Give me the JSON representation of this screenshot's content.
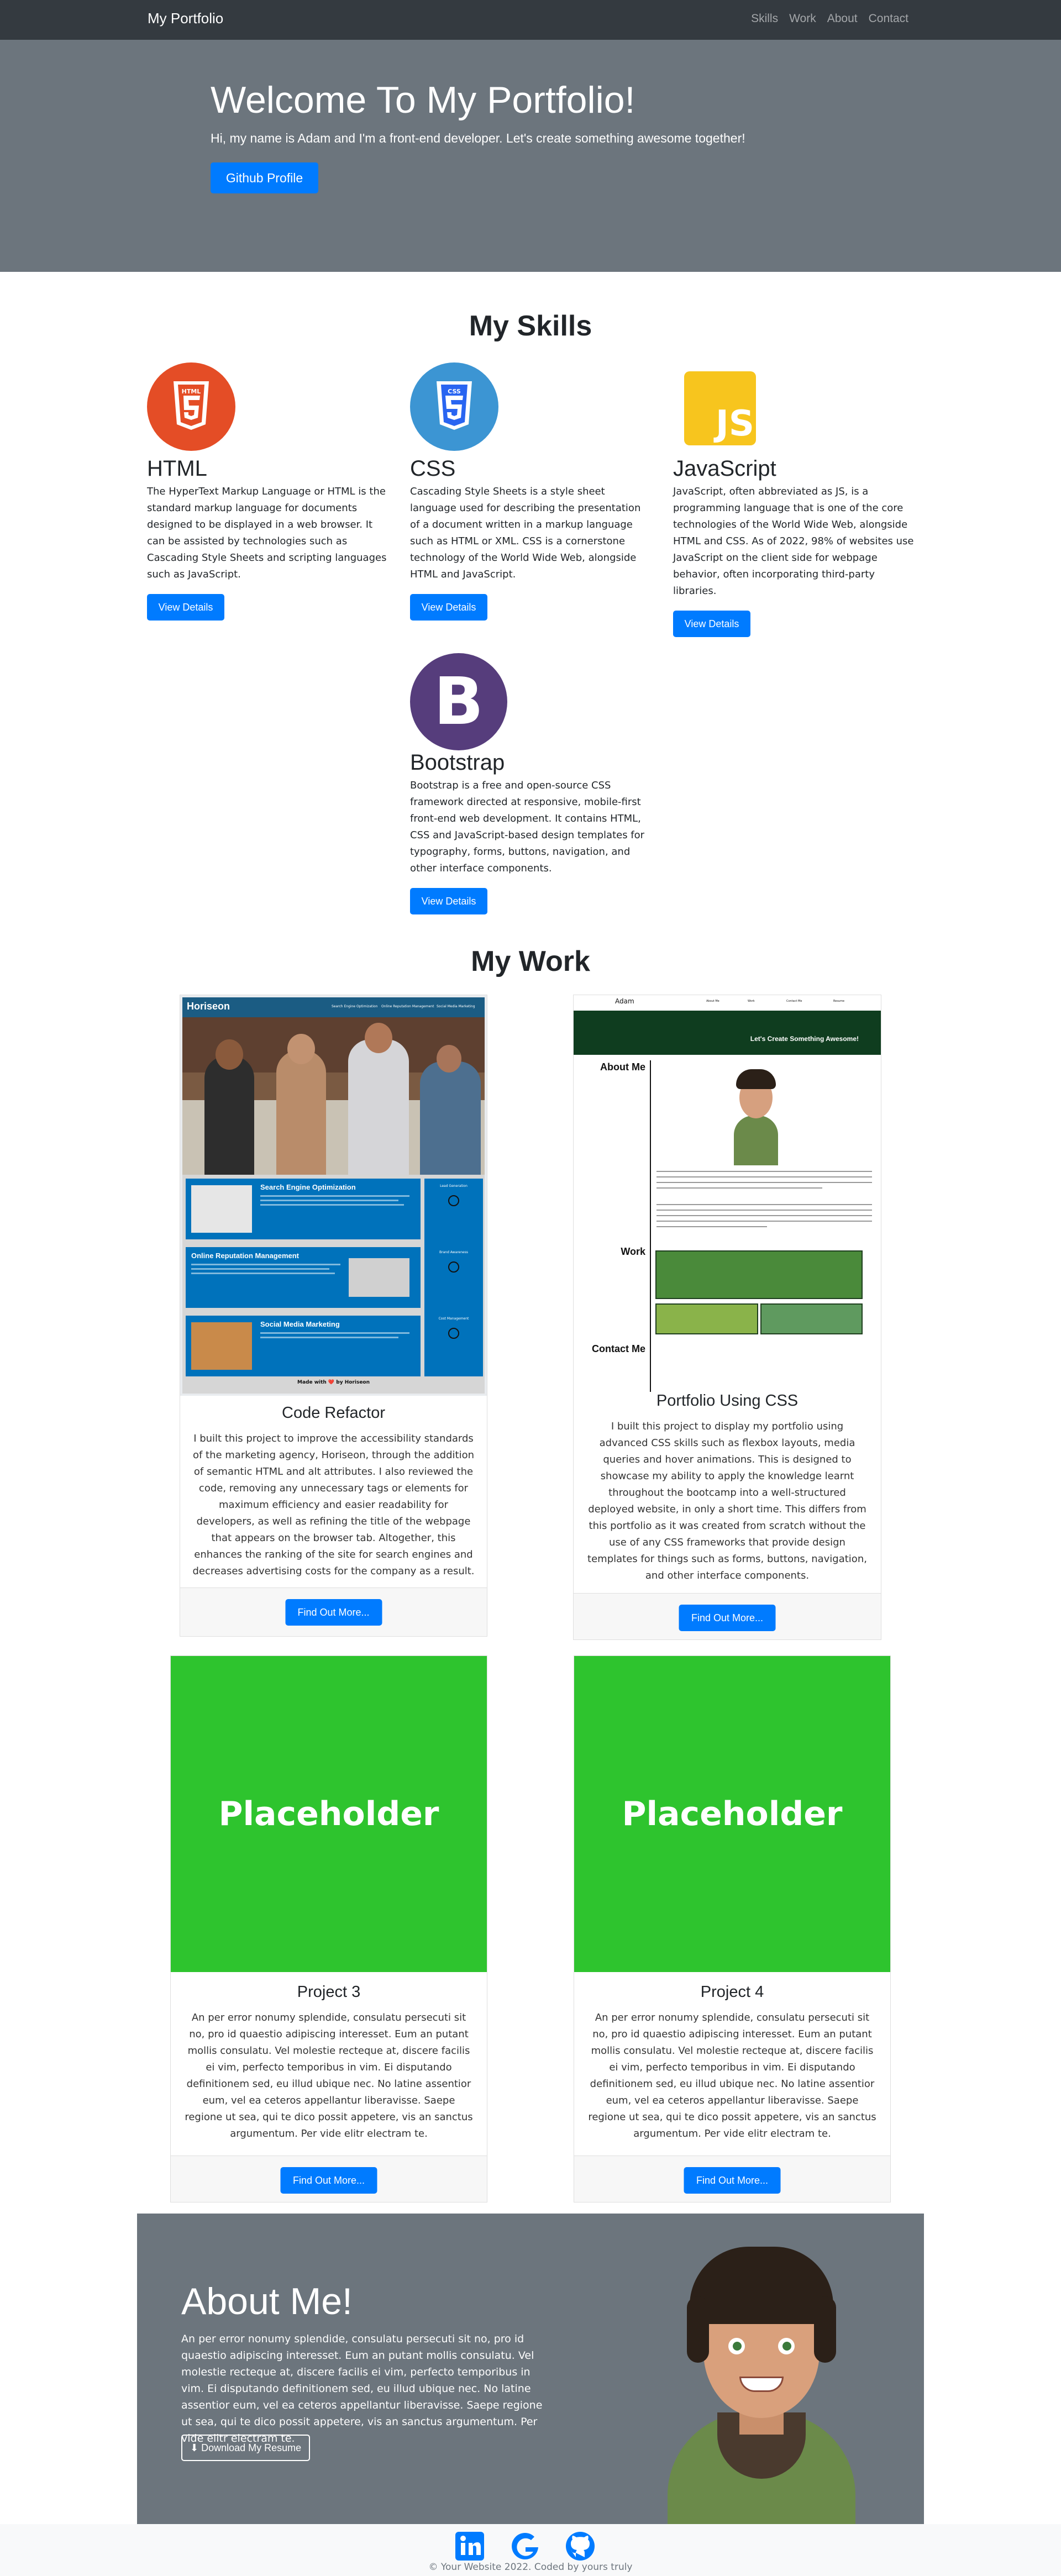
{
  "navbar": {
    "brand": "My Portfolio",
    "links": [
      "Skills",
      "Work",
      "About",
      "Contact"
    ]
  },
  "hero": {
    "title": "Welcome To My Portfolio!",
    "subtitle": "Hi, my name is Adam and I'm a front-end developer. Let's create something awesome together!",
    "button": "Github Profile"
  },
  "skills": {
    "title": "My Skills",
    "items": [
      {
        "name": "HTML",
        "logo_text": "HTML",
        "color": "#e44d26",
        "desc": "The HyperText Markup Language or HTML is the standard markup language for documents designed to be displayed in a web browser. It can be assisted by technologies such as Cascading Style Sheets and scripting languages such as JavaScript.",
        "button": "View Details"
      },
      {
        "name": "CSS",
        "logo_text": "CSS",
        "color": "#2965f1",
        "desc": "Cascading Style Sheets is a style sheet language used for describing the presentation of a document written in a markup language such as HTML or XML. CSS is a cornerstone technology of the World Wide Web, alongside HTML and JavaScript.",
        "button": "View Details"
      },
      {
        "name": "JavaScript",
        "logo_text": "JS",
        "color": "#f7df1e",
        "desc": "JavaScript, often abbreviated as JS, is a programming language that is one of the core technologies of the World Wide Web, alongside HTML and CSS. As of 2022, 98% of websites use JavaScript on the client side for webpage behavior, often incorporating third-party libraries.",
        "button": "View Details"
      },
      {
        "name": "Bootstrap",
        "logo_text": "B",
        "color": "#563d7c",
        "desc": "Bootstrap is a free and open-source CSS framework directed at responsive, mobile-first front-end web development. It contains HTML, CSS and JavaScript-based design templates for typography, forms, buttons, navigation, and other interface components.",
        "button": "View Details"
      }
    ]
  },
  "work": {
    "title": "My Work",
    "cards": [
      {
        "title": "Code Refactor",
        "desc": "I built this project to improve the accessibility standards of the marketing agency, Horiseon, through the addition of semantic HTML and alt attributes. I also reviewed the code, removing any unnecessary tags or elements for maximum efficiency and easier readability for developers, as well as refining the title of the webpage that appears on the browser tab. Altogether, this enhances the ranking of the site for search engines and decreases advertising costs for the company as a result.",
        "button": "Find Out More...",
        "thumb": {
          "brand": "Horiseon",
          "nav": [
            "Search Engine Optimization",
            "Online Reputation Management",
            "Social Media Marketing"
          ],
          "sections": [
            "Search Engine Optimization",
            "Online Reputation Management",
            "Social Media Marketing"
          ],
          "sidebar": [
            "Lead Generation",
            "Brand Awareness",
            "Cost Management"
          ],
          "footer": "Made with ❤️ by Horiseon"
        }
      },
      {
        "title": "Portfolio Using CSS",
        "desc": "I built this project to display my portfolio using advanced CSS skills such as flexbox layouts, media queries and hover animations. This is designed to showcase my ability to apply the knowledge learnt throughout the bootcamp into a well-structured deployed website, in only a short time. This differs from this portfolio as it was created from scratch without the use of any CSS frameworks that provide design templates for things such as forms, buttons, navigation, and other interface components.",
        "button": "Find Out More...",
        "thumb": {
          "brand": "Adam",
          "nav": [
            "About Me",
            "Work",
            "Contact Me",
            "Resume"
          ],
          "banner": "Let's Create Something Awesome!",
          "sections": [
            "About Me",
            "Work",
            "Contact Me"
          ]
        }
      },
      {
        "title": "Project 3",
        "placeholder": "Placeholder",
        "desc": "An per error nonumy splendide, consulatu persecuti sit no, pro id quaestio adipiscing interesset. Eum an putant mollis consulatu. Vel molestie recteque at, discere facilis ei vim, perfecto temporibus in vim. Ei disputando definitionem sed, eu illud ubique nec. No latine assentior eum, vel ea ceteros appellantur liberavisse. Saepe regione ut sea, qui te dico possit appetere, vis an sanctus argumentum. Per vide elitr electram te.",
        "button": "Find Out More..."
      },
      {
        "title": "Project 4",
        "placeholder": "Placeholder",
        "desc": "An per error nonumy splendide, consulatu persecuti sit no, pro id quaestio adipiscing interesset. Eum an putant mollis consulatu. Vel molestie recteque at, discere facilis ei vim, perfecto temporibus in vim. Ei disputando definitionem sed, eu illud ubique nec. No latine assentior eum, vel ea ceteros appellantur liberavisse. Saepe regione ut sea, qui te dico possit appetere, vis an sanctus argumentum. Per vide elitr electram te.",
        "button": "Find Out More..."
      }
    ]
  },
  "about": {
    "title": "About Me!",
    "desc": "An per error nonumy splendide, consulatu persecuti sit no, pro id quaestio adipiscing interesset. Eum an putant mollis consulatu. Vel molestie recteque at, discere facilis ei vim, perfecto temporibus in vim. Ei disputando definitionem sed, eu illud ubique nec. No latine assentior eum, vel ea ceteros appellantur liberavisse. Saepe regione ut sea, qui te dico possit appetere, vis an sanctus argumentum. Per vide elitr electram te.",
    "button": "Download My Resume"
  },
  "footer": {
    "icons": [
      "linkedin-icon",
      "google-icon",
      "github-icon"
    ],
    "copyright": "© Your Website 2022. Coded by yours truly"
  },
  "colors": {
    "primary": "#007bff",
    "navbar": "#343a40",
    "hero": "#6c757d",
    "placeholder": "#2ec42e"
  }
}
